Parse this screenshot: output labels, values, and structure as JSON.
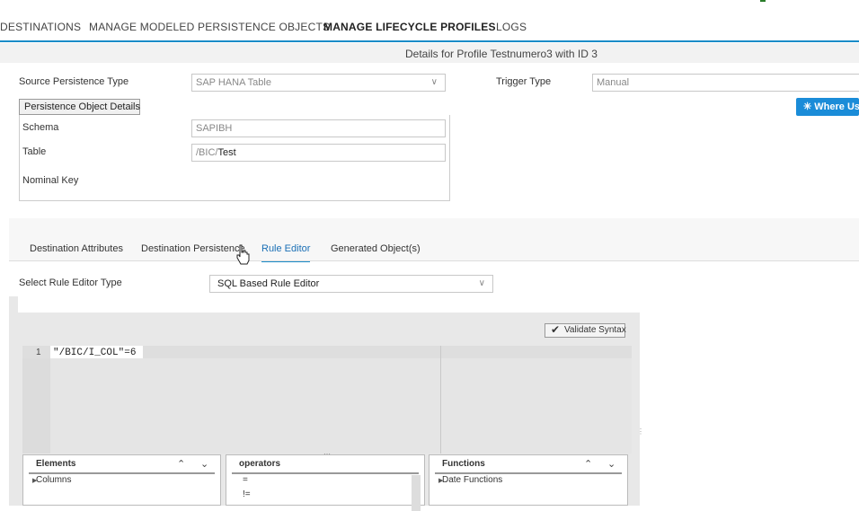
{
  "nav": {
    "items": [
      {
        "label": "DESTINATIONS",
        "active": false
      },
      {
        "label": "MANAGE MODELED PERSISTENCE OBJECTS",
        "active": false
      },
      {
        "label": "MANAGE LIFECYCLE PROFILES",
        "active": true
      },
      {
        "label": "LOGS",
        "active": false
      }
    ]
  },
  "details_title": "Details for Profile Testnumero3 with ID 3",
  "form": {
    "source_persistence_type_label": "Source Persistence Type",
    "source_persistence_type_value": "SAP HANA Table",
    "trigger_type_label": "Trigger Type",
    "trigger_type_value": "Manual",
    "persistence_object_details_button": "Persistence Object Details",
    "where_used_button": "Where Us",
    "schema_label": "Schema",
    "schema_value": "SAPIBH",
    "table_label": "Table",
    "table_prefix": "/BIC/",
    "table_value": "Test",
    "nominal_key_label": "Nominal Key"
  },
  "tabs": [
    {
      "label": "Destination Attributes",
      "active": false
    },
    {
      "label": "Destination Persistence",
      "active": false
    },
    {
      "label": "Rule Editor",
      "active": true
    },
    {
      "label": "Generated Object(s)",
      "active": false
    }
  ],
  "rule_editor": {
    "type_label": "Select Rule Editor Type",
    "type_value": "SQL Based Rule Editor",
    "validate_button": "Validate Syntax",
    "line_number": "1",
    "code": "\"/BIC/I_COL\"=6",
    "panes": {
      "elements": {
        "title": "Elements",
        "items": [
          "Columns"
        ]
      },
      "operators": {
        "title": "operators",
        "items": [
          "=",
          "!="
        ]
      },
      "functions": {
        "title": "Functions",
        "items": [
          "Date Functions"
        ]
      }
    }
  },
  "colors": {
    "accent": "#1a8cc8",
    "button_blue": "#1a8cd8"
  }
}
